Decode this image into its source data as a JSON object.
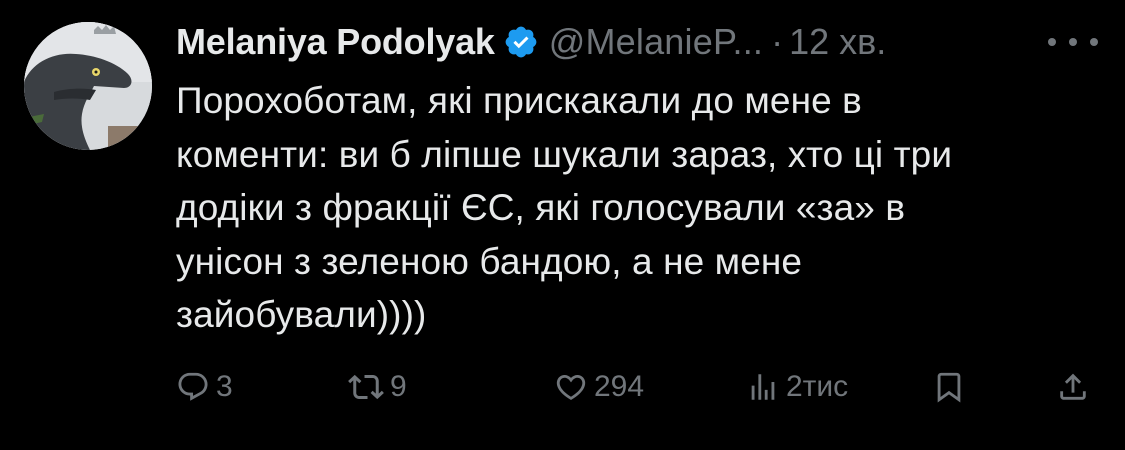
{
  "tweet": {
    "author": {
      "display_name": "Melaniya Podolyak",
      "handle": "@MelanieP...",
      "verified": true
    },
    "separator": "·",
    "time": "12 хв.",
    "text": "Порохоботам, які прискакали до мене в\nкоменти: ви б ліпше шукали зараз, хто ці три\nдодіки з фракції ЄС, які голосували «за» в\nунісон з зеленою бандою, а не мене\nзайобували))))",
    "stats": {
      "replies": "3",
      "retweets": "9",
      "likes": "294",
      "views": "2тис"
    }
  },
  "icons": {
    "verified": "verified-badge-icon",
    "more": "more-options-icon",
    "reply": "reply-icon",
    "retweet": "retweet-icon",
    "like": "heart-icon",
    "views": "views-chart-icon",
    "bookmark": "bookmark-icon",
    "share": "share-icon"
  },
  "colors": {
    "background": "#000000",
    "text": "#e7e9ea",
    "secondary": "#71767b",
    "verified": "#1d9bf0"
  }
}
